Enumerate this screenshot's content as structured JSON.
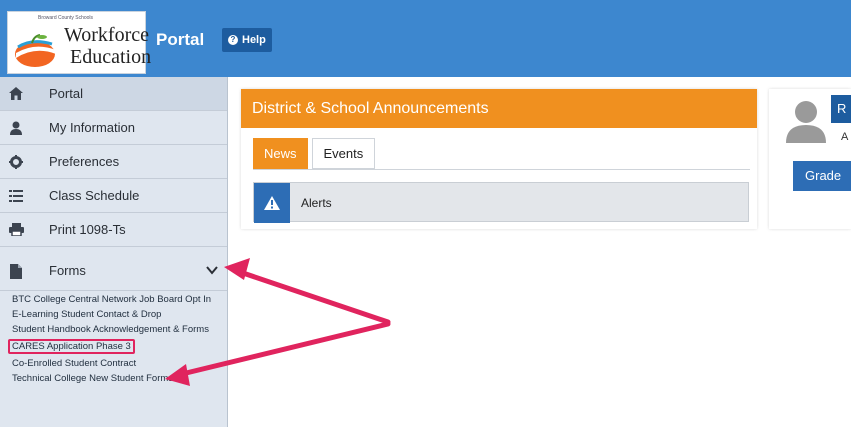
{
  "header": {
    "logo_small": "Broward County Schools",
    "logo_line1": "Workforce",
    "logo_line2": "Education",
    "title": "Portal",
    "help_label": "Help",
    "help_icon": "question-circle-icon",
    "bg_color": "#3d87cf"
  },
  "sidebar": {
    "items": [
      {
        "label": "Portal",
        "icon": "home-icon"
      },
      {
        "label": "My Information",
        "icon": "user-icon"
      },
      {
        "label": "Preferences",
        "icon": "gear-icon"
      },
      {
        "label": "Class Schedule",
        "icon": "list-icon"
      },
      {
        "label": "Print 1098-Ts",
        "icon": "print-icon"
      }
    ],
    "forms": {
      "label": "Forms",
      "icon": "file-icon",
      "expand_icon": "chevron-down-icon"
    },
    "form_links": [
      "BTC College Central Network Job Board Opt In",
      "E-Learning Student Contact & Drop",
      "Student Handbook Acknowledgement & Forms",
      "CARES Application Phase 3",
      "Co-Enrolled Student Contract",
      "Technical College New Student Forms"
    ]
  },
  "announcements": {
    "title": "District & School Announcements",
    "tabs": [
      "News",
      "Events"
    ],
    "alerts_label": "Alerts",
    "accent_color": "#f0901f"
  },
  "profile": {
    "name_initial": "R",
    "sub_initial": "A",
    "grade_label": "Grade"
  },
  "annotation": {
    "color": "#e0245e"
  }
}
